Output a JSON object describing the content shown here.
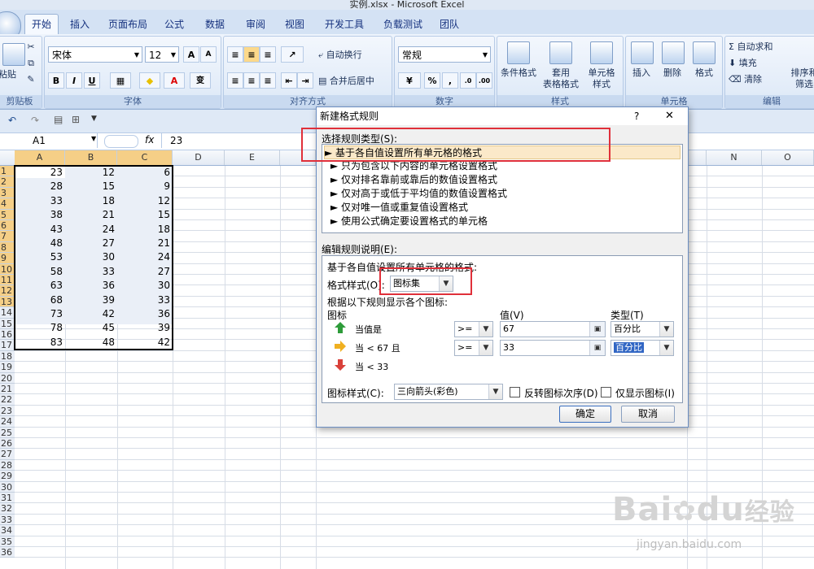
{
  "window": {
    "title": "实例.xlsx - Microsoft Excel"
  },
  "ribbon_tabs": [
    "开始",
    "插入",
    "页面布局",
    "公式",
    "数据",
    "审阅",
    "视图",
    "开发工具",
    "负载测试",
    "团队"
  ],
  "ribbon": {
    "clipboard": {
      "label": "剪贴板",
      "paste": "粘贴"
    },
    "font": {
      "label": "字体",
      "name": "宋体",
      "size": "12",
      "grow": "A",
      "shrink": "A",
      "bold": "B",
      "italic": "I",
      "underline": "U",
      "color_letter": "A",
      "phonetic": "变"
    },
    "alignment": {
      "label": "对齐方式",
      "wrap": "自动换行",
      "merge": "合并后居中"
    },
    "number": {
      "label": "数字",
      "format": "常规",
      "percent": "%",
      "comma": ","
    },
    "styles": {
      "label": "样式",
      "conditional": "条件格式",
      "table1": "套用",
      "table2": "表格格式",
      "cell1": "单元格",
      "cell2": "样式"
    },
    "cells": {
      "label": "单元格",
      "insert": "插入",
      "delete": "删除",
      "format": "格式"
    },
    "editing": {
      "label": "编辑",
      "autosum": "自动求和",
      "fill": "填充",
      "clear": "清除",
      "sort1": "排序和",
      "sort2": "筛选"
    }
  },
  "formula_bar": {
    "name_box": "A1",
    "fx": "fx",
    "value": "23"
  },
  "columns": [
    "A",
    "B",
    "C",
    "D",
    "E",
    "N",
    "O"
  ],
  "row_numbers": [
    "1",
    "2",
    "3",
    "4",
    "5",
    "6",
    "7",
    "8",
    "9",
    "10",
    "11",
    "12",
    "13",
    "14",
    "15",
    "16",
    "17",
    "18",
    "19",
    "20",
    "21",
    "22",
    "23",
    "24",
    "25",
    "26",
    "27",
    "28",
    "29",
    "30",
    "31",
    "32",
    "33",
    "34",
    "35",
    "36"
  ],
  "cells": [
    [
      "23",
      "12",
      "6"
    ],
    [
      "28",
      "15",
      "9"
    ],
    [
      "33",
      "18",
      "12"
    ],
    [
      "38",
      "21",
      "15"
    ],
    [
      "43",
      "24",
      "18"
    ],
    [
      "48",
      "27",
      "21"
    ],
    [
      "53",
      "30",
      "24"
    ],
    [
      "58",
      "33",
      "27"
    ],
    [
      "63",
      "36",
      "30"
    ],
    [
      "68",
      "39",
      "33"
    ],
    [
      "73",
      "42",
      "36"
    ],
    [
      "78",
      "45",
      "39"
    ],
    [
      "83",
      "48",
      "42"
    ]
  ],
  "dialog": {
    "title": "新建格式规则",
    "help": "?",
    "close": "✕",
    "select_rule_label": "选择规则类型(S):",
    "rule_types": [
      "► 基于各自值设置所有单元格的格式",
      "► 只为包含以下内容的单元格设置格式",
      "► 仅对排名靠前或靠后的数值设置格式",
      "► 仅对高于或低于平均值的数值设置格式",
      "► 仅对唯一值或重复值设置格式",
      "► 使用公式确定要设置格式的单元格"
    ],
    "edit_rule_label": "编辑规则说明(E):",
    "edit_heading": "基于各自值设置所有单元格的格式:",
    "format_style_label": "格式样式(O):",
    "format_style_value": "图标集",
    "rule_desc": "根据以下规则显示各个图标:",
    "col_icon": "图标",
    "col_value": "值(V)",
    "col_type": "类型(T)",
    "rows": [
      {
        "text": "当值是",
        "op": ">=",
        "value": "67",
        "type": "百分比"
      },
      {
        "text": "当 < 67 且",
        "op": ">=",
        "value": "33",
        "type": "百分比"
      },
      {
        "text": "当 < 33"
      }
    ],
    "icon_style_label": "图标样式(C):",
    "icon_style_value": "三向箭头(彩色)",
    "reverse_label": "反转图标次序(D)",
    "icon_only_label": "仅显示图标(I)",
    "ok": "确定",
    "cancel": "取消"
  },
  "watermark": {
    "brand": "Bai",
    "brand2": "du",
    "cn": "经验",
    "url": "jingyan.baidu.com"
  },
  "colors": {
    "accent_red": "#e0303a",
    "selection": "#f5cf87",
    "ribbon": "#d4e2f4",
    "arrow_up": "#2e9c3a",
    "arrow_mid": "#f0b020",
    "arrow_down": "#d9413a"
  }
}
